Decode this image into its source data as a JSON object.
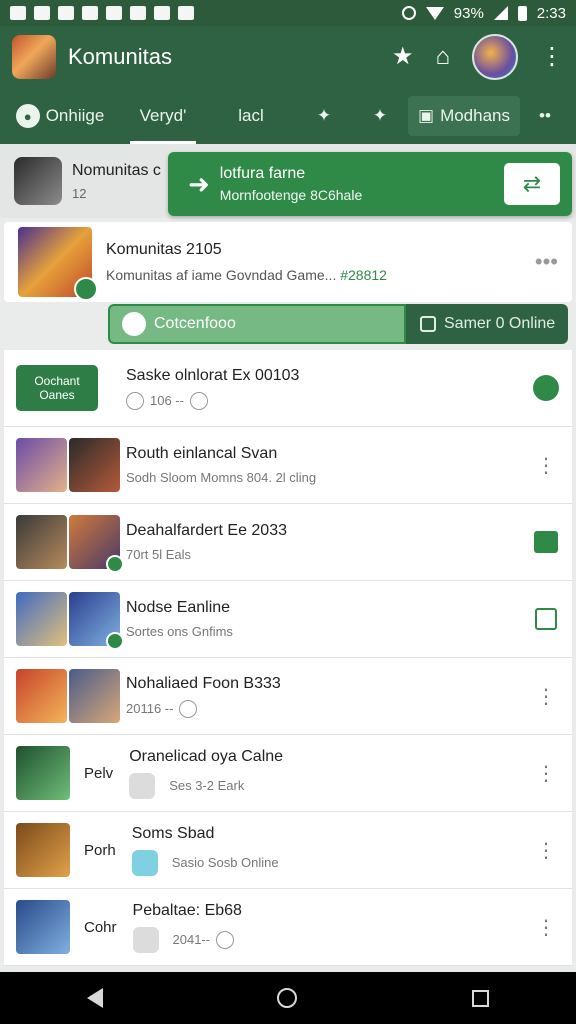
{
  "status_bar": {
    "battery": "93%",
    "time": "2:33"
  },
  "app_bar": {
    "title": "Komunitas"
  },
  "tabs": [
    {
      "label": "Onhiige"
    },
    {
      "label": "Veryd'"
    },
    {
      "label": "lacl"
    },
    {
      "label": "Modhans"
    }
  ],
  "pinned": {
    "title": "Nomunitas c",
    "sub": "12"
  },
  "banner": {
    "title": "lotfura farne",
    "sub": "Mornfootenge 8C6hale"
  },
  "hero": {
    "title": "Komunitas 2105",
    "sub": "Komunitas af iame Govndad Game...",
    "tag": "#28812"
  },
  "pills": {
    "primary": "Cotcenfooo",
    "secondary": "Samer 0 Online"
  },
  "join_button": {
    "line1": "Oochant",
    "line2": "Oanes"
  },
  "rows": [
    {
      "title": "Saske olnlorat Ex 00103",
      "sub": "106 --"
    },
    {
      "title": "Routh einlancal Svan",
      "sub": "Sodh Sloom Momns 804. 2l cling"
    },
    {
      "title": "Deahalfardert Ee 2033",
      "sub": "70rt 5l Eals"
    },
    {
      "title": "Nodse Eanline",
      "sub": "Sortes ons Gnfims"
    },
    {
      "title": "Nohaliaed Foon B333",
      "sub": "20116 --"
    },
    {
      "prefix": "Pelv",
      "title": "Oranelicad oya Calne",
      "sub": "Ses 3-2 Eark"
    },
    {
      "prefix": "Porh",
      "title": "Soms Sbad",
      "sub": "Sasio Sosb Online"
    },
    {
      "prefix": "Cohr",
      "title": "Pebaltae: Eb68",
      "sub": "2041--"
    }
  ],
  "colors": {
    "primary": "#2f6242",
    "accent": "#2f8a48"
  }
}
